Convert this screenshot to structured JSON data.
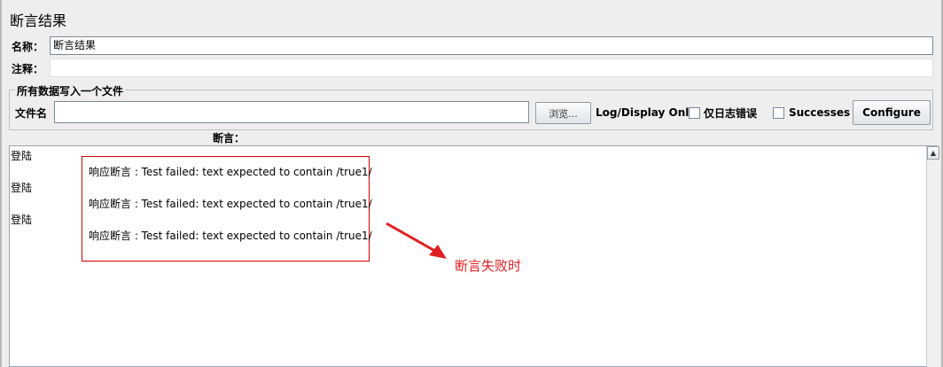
{
  "panel": {
    "title": "断言结果"
  },
  "name_row": {
    "label": "名称：",
    "value": "断言结果"
  },
  "comment_row": {
    "label": "注释：",
    "value": ""
  },
  "file_group": {
    "legend": "所有数据写入一个文件",
    "filename_label": "文件名",
    "filename_value": "",
    "browse_label": "浏览...",
    "log_display_label": "Log/Display Only:",
    "errors_only_label": "仅日志错误",
    "successes_label": "Successes",
    "configure_label": "Configure"
  },
  "assertions": {
    "header": "断言：",
    "items": [
      "登陆",
      "登陆",
      "登陆"
    ],
    "messages": [
      "响应断言 : Test failed: text expected to contain /true1/",
      "响应断言 : Test failed: text expected to contain /true1/",
      "响应断言 : Test failed: text expected to contain /true1/"
    ]
  },
  "annotation": {
    "text": "断言失败时",
    "color": "#e02020"
  },
  "icons": {
    "scroll_up": "scroll-up-arrow-icon",
    "arrow": "red-arrow-icon"
  }
}
